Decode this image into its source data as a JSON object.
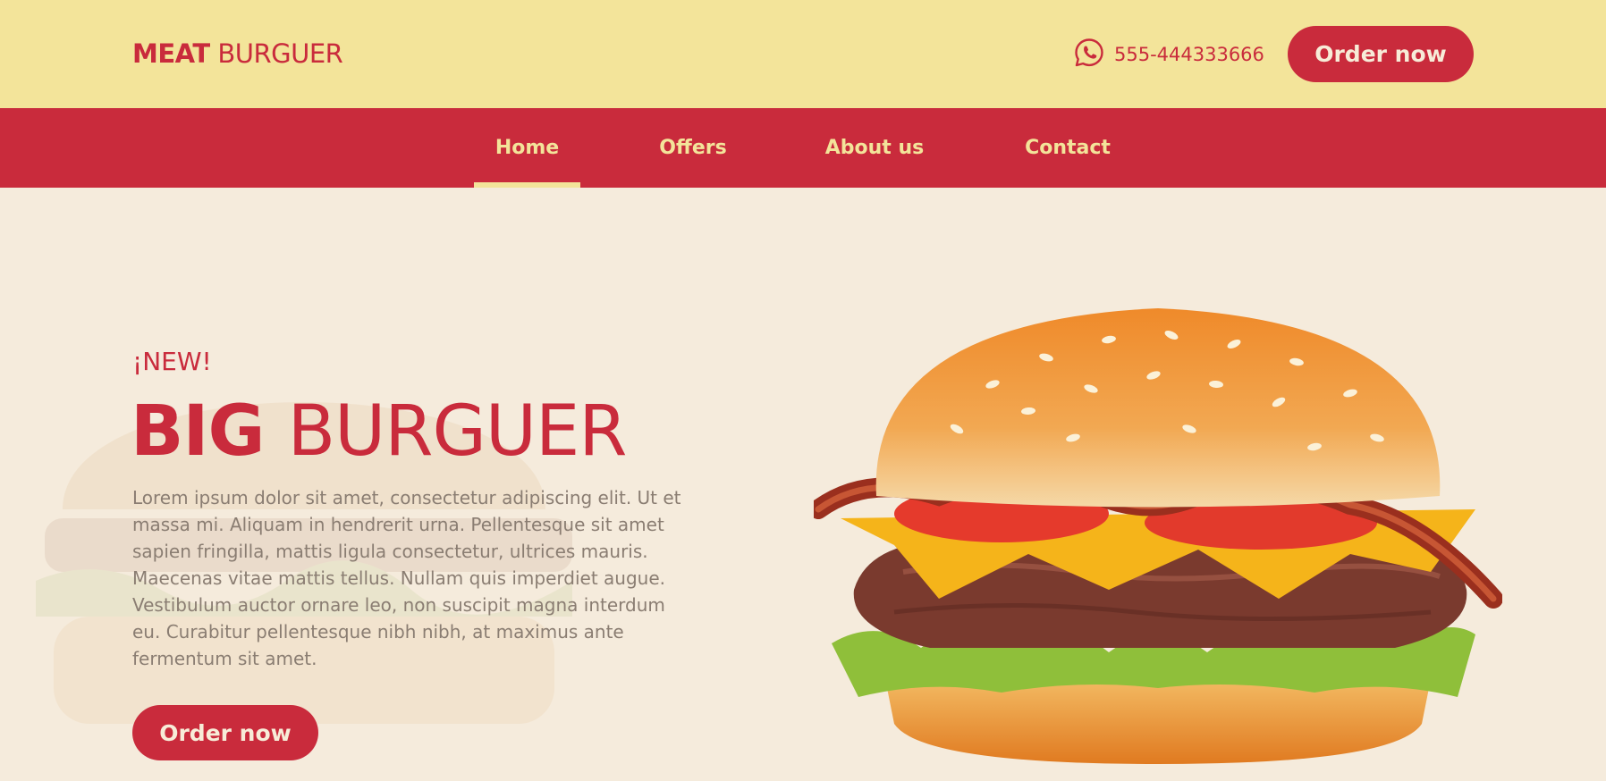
{
  "header": {
    "logo_bold": "MEAT",
    "logo_light": "BURGUER",
    "phone_icon": "whatsapp-icon",
    "phone": "555-444333666",
    "order_label": "Order now"
  },
  "nav": {
    "items": [
      {
        "label": "Home",
        "active": true
      },
      {
        "label": "Offers",
        "active": false
      },
      {
        "label": "About us",
        "active": false
      },
      {
        "label": "Contact",
        "active": false
      }
    ]
  },
  "hero": {
    "kicker": "¡NEW!",
    "title_bold": "BIG",
    "title_light": "BURGUER",
    "description": "Lorem ipsum dolor sit amet, consectetur adipiscing elit. Ut et massa mi. Aliquam in hendrerit urna. Pellentesque sit amet sapien fringilla, mattis ligula consectetur, ultrices mauris. Maecenas vitae mattis tellus. Nullam quis imperdiet augue. Vestibulum auctor ornare leo, non suscipit magna interdum eu. Curabitur pellentesque nibh nibh, at maximus ante fermentum sit amet.",
    "order_label": "Order now"
  },
  "colors": {
    "brand_red": "#c92b3c",
    "top_yellow": "#f3e49a",
    "background": "#f5ebdc",
    "text_muted": "#8a7d72"
  }
}
